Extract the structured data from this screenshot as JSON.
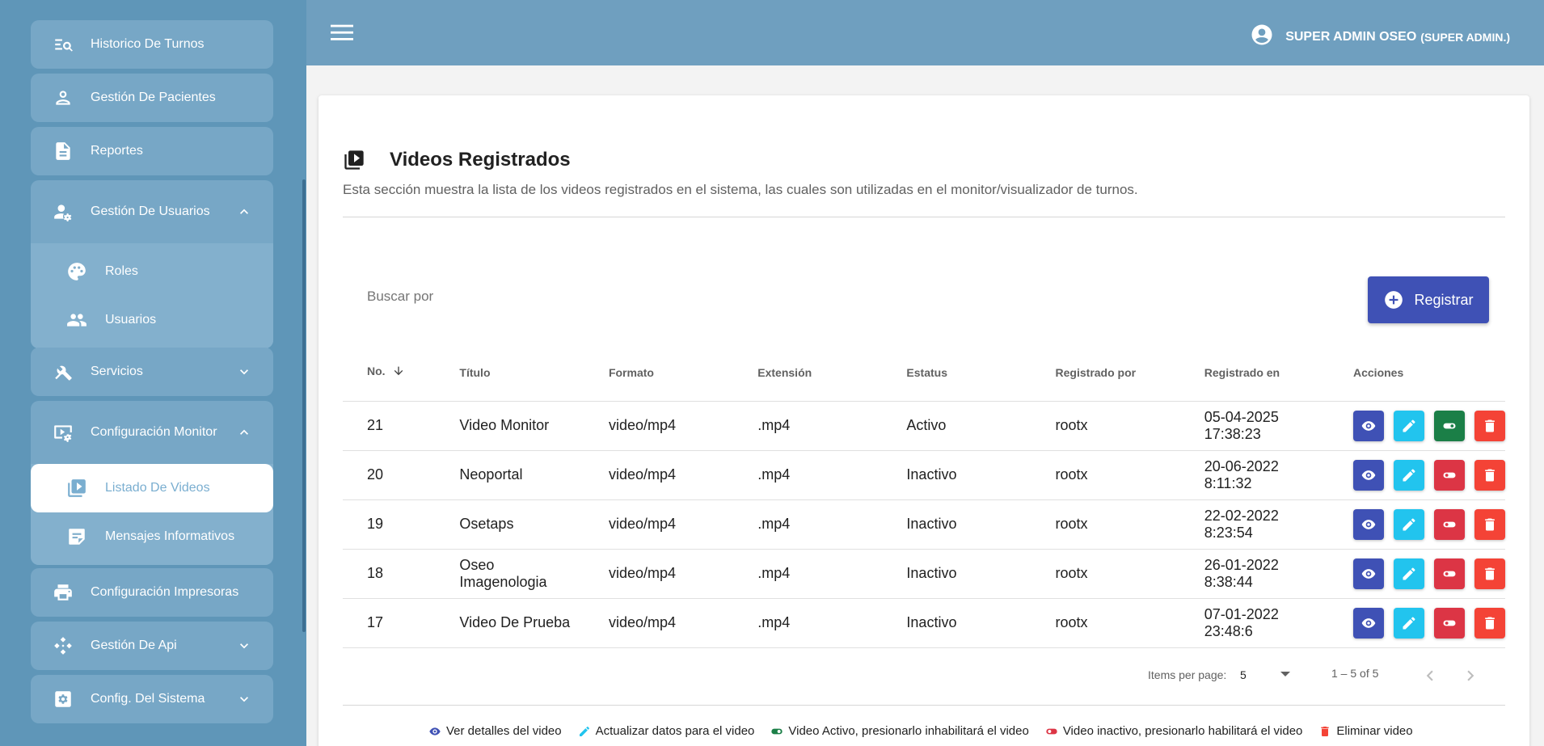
{
  "sidebar": {
    "items": [
      {
        "label": "Historico De Turnos"
      },
      {
        "label": "Gestión De Pacientes"
      },
      {
        "label": "Reportes"
      },
      {
        "label": "Gestión De Usuarios"
      },
      {
        "label": "Servicios"
      },
      {
        "label": "Configuración Monitor"
      },
      {
        "label": "Configuración Impresoras"
      },
      {
        "label": "Gestión De Api"
      },
      {
        "label": "Config. Del Sistema"
      }
    ],
    "usuarios_sub": [
      {
        "label": "Roles"
      },
      {
        "label": "Usuarios"
      }
    ],
    "monitor_sub": [
      {
        "label": "Listado De Videos"
      },
      {
        "label": "Mensajes Informativos"
      }
    ]
  },
  "header": {
    "user_name": "SUPER ADMIN OSEO",
    "user_role": "(SUPER ADMIN.)"
  },
  "main": {
    "title": "Videos Registrados",
    "description": "Esta sección muestra la lista de los videos registrados en el sistema, las cuales son utilizadas en el monitor/visualizador de turnos.",
    "search_label": "Buscar por",
    "register_label": "Registrar",
    "columns": [
      "No.",
      "Título",
      "Formato",
      "Extensión",
      "Estatus",
      "Registrado por",
      "Registrado en",
      "Acciones"
    ],
    "rows": [
      {
        "no": "21",
        "titulo": "Video Monitor",
        "formato": "video/mp4",
        "extension": ".mp4",
        "estatus": "Activo",
        "por": "rootx",
        "en": "05-04-2025 17:38:23",
        "active": true
      },
      {
        "no": "20",
        "titulo": "Neoportal",
        "formato": "video/mp4",
        "extension": ".mp4",
        "estatus": "Inactivo",
        "por": "rootx",
        "en": "20-06-2022 8:11:32",
        "active": false
      },
      {
        "no": "19",
        "titulo": "Osetaps",
        "formato": "video/mp4",
        "extension": ".mp4",
        "estatus": "Inactivo",
        "por": "rootx",
        "en": "22-02-2022 8:23:54",
        "active": false
      },
      {
        "no": "18",
        "titulo": "Oseo Imagenologia",
        "formato": "video/mp4",
        "extension": ".mp4",
        "estatus": "Inactivo",
        "por": "rootx",
        "en": "26-01-2022 8:38:44",
        "active": false
      },
      {
        "no": "17",
        "titulo": "Video De Prueba",
        "formato": "video/mp4",
        "extension": ".mp4",
        "estatus": "Inactivo",
        "por": "rootx",
        "en": "07-01-2022 23:48:6",
        "active": false
      }
    ],
    "pagination": {
      "items_per_page_label": "Items per page:",
      "items_per_page": "5",
      "range": "1 – 5 of 5"
    },
    "legend": [
      "Ver detalles del video",
      "Actualizar datos para el video",
      "Video Activo, presionarlo inhabilitará el video",
      "Video inactivo, presionarlo habilitará el video",
      "Eliminar video"
    ]
  },
  "colors": {
    "sidebar_bg": "#5f96b8",
    "topbar_bg": "#6f9fbf",
    "primary": "#3f51b5",
    "edit": "#22c4ee",
    "active_toggle": "#1b7f47",
    "inactive_toggle": "#dc3545",
    "delete": "#f44336"
  }
}
